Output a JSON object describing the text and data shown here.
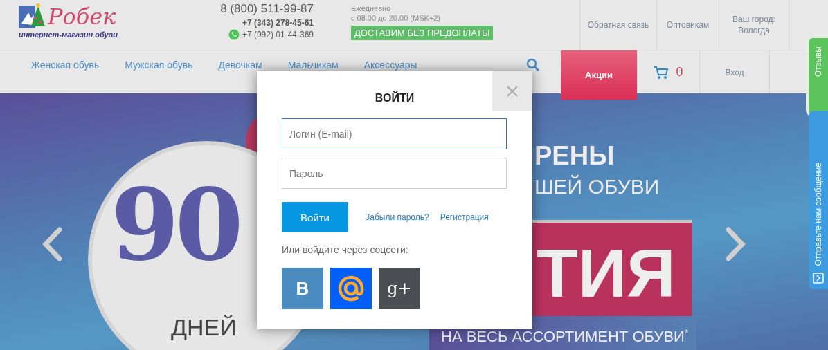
{
  "logo": {
    "name": "Робек",
    "tagline": "интернет-магазин обуви"
  },
  "contacts": {
    "main_phone": "8 (800) 511-99-87",
    "phone_2": "+7 (343) 278-45-61",
    "whatsapp_phone": "+7 (992) 01-44-369"
  },
  "schedule": {
    "days": "Ежедневно",
    "hours": "с 08.00 до 20.00 (MSK+2)",
    "delivery_badge": "ДОСТАВИМ БЕЗ ПРЕДОПЛАТЫ"
  },
  "top_links": [
    "Обратная связь",
    "Оптовикам"
  ],
  "city": {
    "label": "Ваш город:",
    "value": "Вологда"
  },
  "nav": [
    {
      "label": "Женская обувь"
    },
    {
      "label": "Мужская обувь"
    },
    {
      "label": "Девочкам"
    },
    {
      "label": "Мальчикам"
    },
    {
      "label": "Аксессуары"
    }
  ],
  "promo_tab": "Акции",
  "cart_count": "0",
  "login_link": "Вход",
  "banner": {
    "number": "90",
    "number_caption": "ДНЕЙ",
    "headline_1": "РЕНЫ",
    "headline_2": "ШЕЙ ОБУВИ",
    "headline_3": "ТИЯ",
    "footer": "НА ВЕСЬ АССОРТИМЕНТ ОБУВИ$^{*}$"
  },
  "login_modal": {
    "title": "ВОЙТИ",
    "login_placeholder": "Логин (E-mail)",
    "password_placeholder": "Пароль",
    "submit": "Войти",
    "forgot_link": "Забыли пароль?",
    "register_link": "Регистрация",
    "social_caption": "Или войдите через соцсети:",
    "social": [
      {
        "kind": "vk",
        "label": "В"
      },
      {
        "kind": "mail"
      },
      {
        "kind": "gplus",
        "label": "g+"
      }
    ]
  },
  "side_tabs": [
    {
      "kind": "reviews",
      "label": "Отзывы"
    },
    {
      "kind": "message",
      "label": "Отправьте нам сообщение"
    }
  ]
}
